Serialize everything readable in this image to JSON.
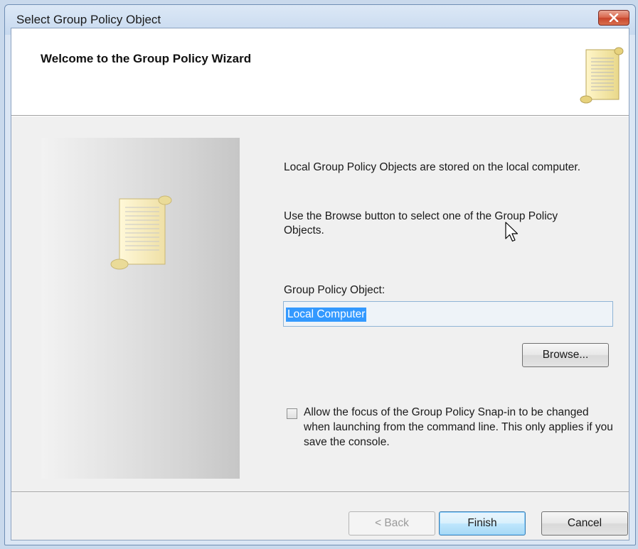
{
  "window": {
    "title": "Select Group Policy Object"
  },
  "header": {
    "title": "Welcome to the Group Policy Wizard",
    "icon": "scroll-icon"
  },
  "side_panel": {
    "icon": "scroll-icon"
  },
  "body": {
    "paragraph1": "Local Group Policy Objects are stored on the local computer.",
    "paragraph2": "Use the Browse button to select one of the Group Policy Objects.",
    "gpo_label": "Group Policy Object:",
    "gpo_value": "Local Computer",
    "browse_label": "Browse...",
    "checkbox_label": "Allow the focus of the Group Policy Snap-in to be changed when launching from the command line.  This only applies if you save the console.",
    "checkbox_checked": false
  },
  "footer": {
    "back_label": "< Back",
    "finish_label": "Finish",
    "cancel_label": "Cancel"
  },
  "colors": {
    "selection": "#3399ff",
    "close_button": "#c8452b",
    "default_button_border": "#3c7fb1"
  }
}
